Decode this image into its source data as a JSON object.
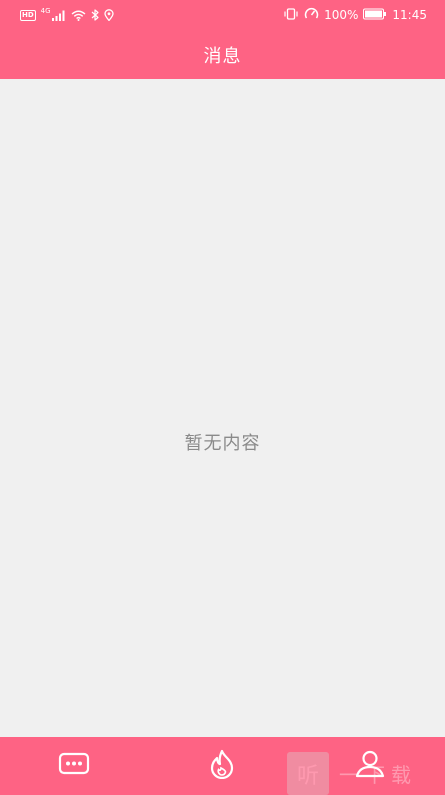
{
  "status_bar": {
    "left_badge": "HD",
    "network_label": "4G",
    "battery_percent": "100%",
    "battery_level": 1.0,
    "time": "11:45",
    "left_icons": [
      "hd-badge-icon",
      "signal-icon",
      "wifi-icon",
      "bluetooth-icon",
      "location-icon"
    ],
    "right_icons": [
      "vibrate-icon",
      "speed-icon",
      "battery-icon"
    ]
  },
  "header": {
    "title": "消息"
  },
  "main": {
    "empty_text": "暂无内容"
  },
  "tab_bar": {
    "tabs": [
      {
        "icon": "chat-bubble-icon"
      },
      {
        "icon": "flame-icon"
      },
      {
        "icon": "user-icon"
      }
    ]
  },
  "watermark": {
    "logo_char": "听",
    "text": "一下载"
  },
  "colors": {
    "accent": "#fe6384",
    "background": "#f0f0f0",
    "empty_text": "#8a8a8a",
    "on_accent": "#ffffff"
  }
}
